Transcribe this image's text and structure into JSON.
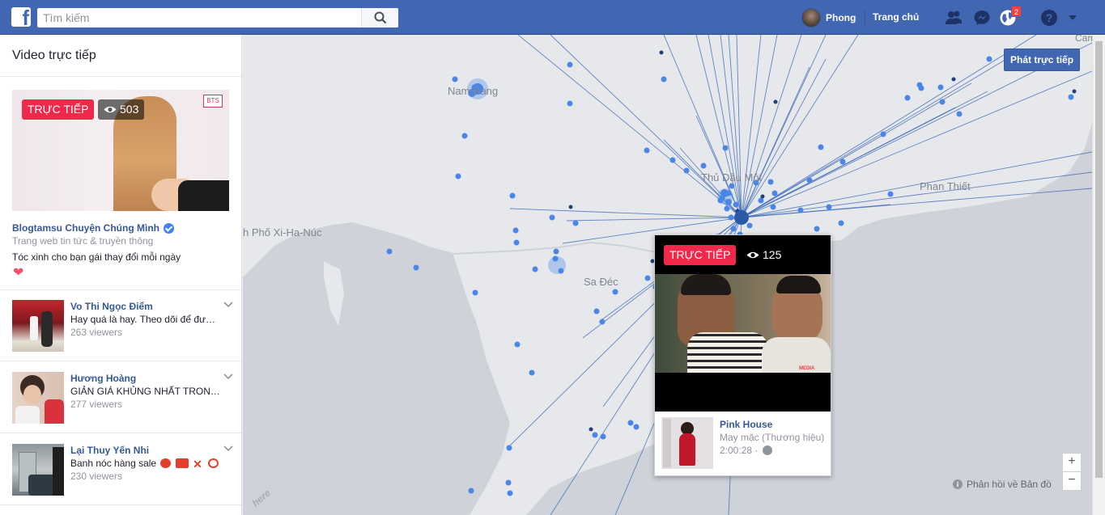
{
  "header": {
    "search_placeholder": "Tìm kiếm",
    "profile_name": "Phong",
    "home_label": "Trang chủ",
    "notification_count": "2"
  },
  "sidebar": {
    "title": "Video trực tiếp",
    "featured": {
      "live_label": "TRỰC TIẾP",
      "views": "503",
      "logo_text": "BTS",
      "name": "Blogtamsu Chuyện Chúng Mình",
      "category": "Trang web tin tức & truyền thông",
      "description": "Tóc xinh cho bạn gái thay đổi mỗi ngày",
      "heart": "❤"
    },
    "items": [
      {
        "name": "Vo Thi Ngọc Điểm",
        "text": "Hay quá là hay. Theo dõi để được...",
        "views": "263 viewers"
      },
      {
        "name": "Hương Hoàng",
        "text": "GIẢN GIÁ KHỦNG NHẤT TRONG...",
        "views": "277 viewers"
      },
      {
        "name": "Lại Thuy Yến Nhi",
        "text": "Banh nóc hàng sale",
        "views": "230 viewers"
      }
    ]
  },
  "map": {
    "go_live": "Phát trực tiếp",
    "feedback": "Phản hồi về Bản đồ",
    "zoom_in": "+",
    "zoom_out": "−",
    "attribution": "here",
    "places": {
      "nam_dang": "Nam Đang",
      "thu_dau_mot": "Thủ Dầu Một",
      "phan_thiet": "Phan Thiết",
      "ho_chi_minh": "h Phố Xi-Ha-Núc",
      "sa_dec": "Sa Đéc",
      "cam": "Cam"
    }
  },
  "popup": {
    "live_label": "TRỰC TIẾP",
    "views": "125",
    "watermark": "MEDIA",
    "name": "Pink House",
    "category": "May mặc (Thương hiệu)",
    "duration": "2:00:28 ·"
  },
  "colors": {
    "brand": "#4267b2",
    "live_red": "#f02849",
    "link": "#365899",
    "dot": "#4a86e8",
    "line": "#3563b5"
  }
}
